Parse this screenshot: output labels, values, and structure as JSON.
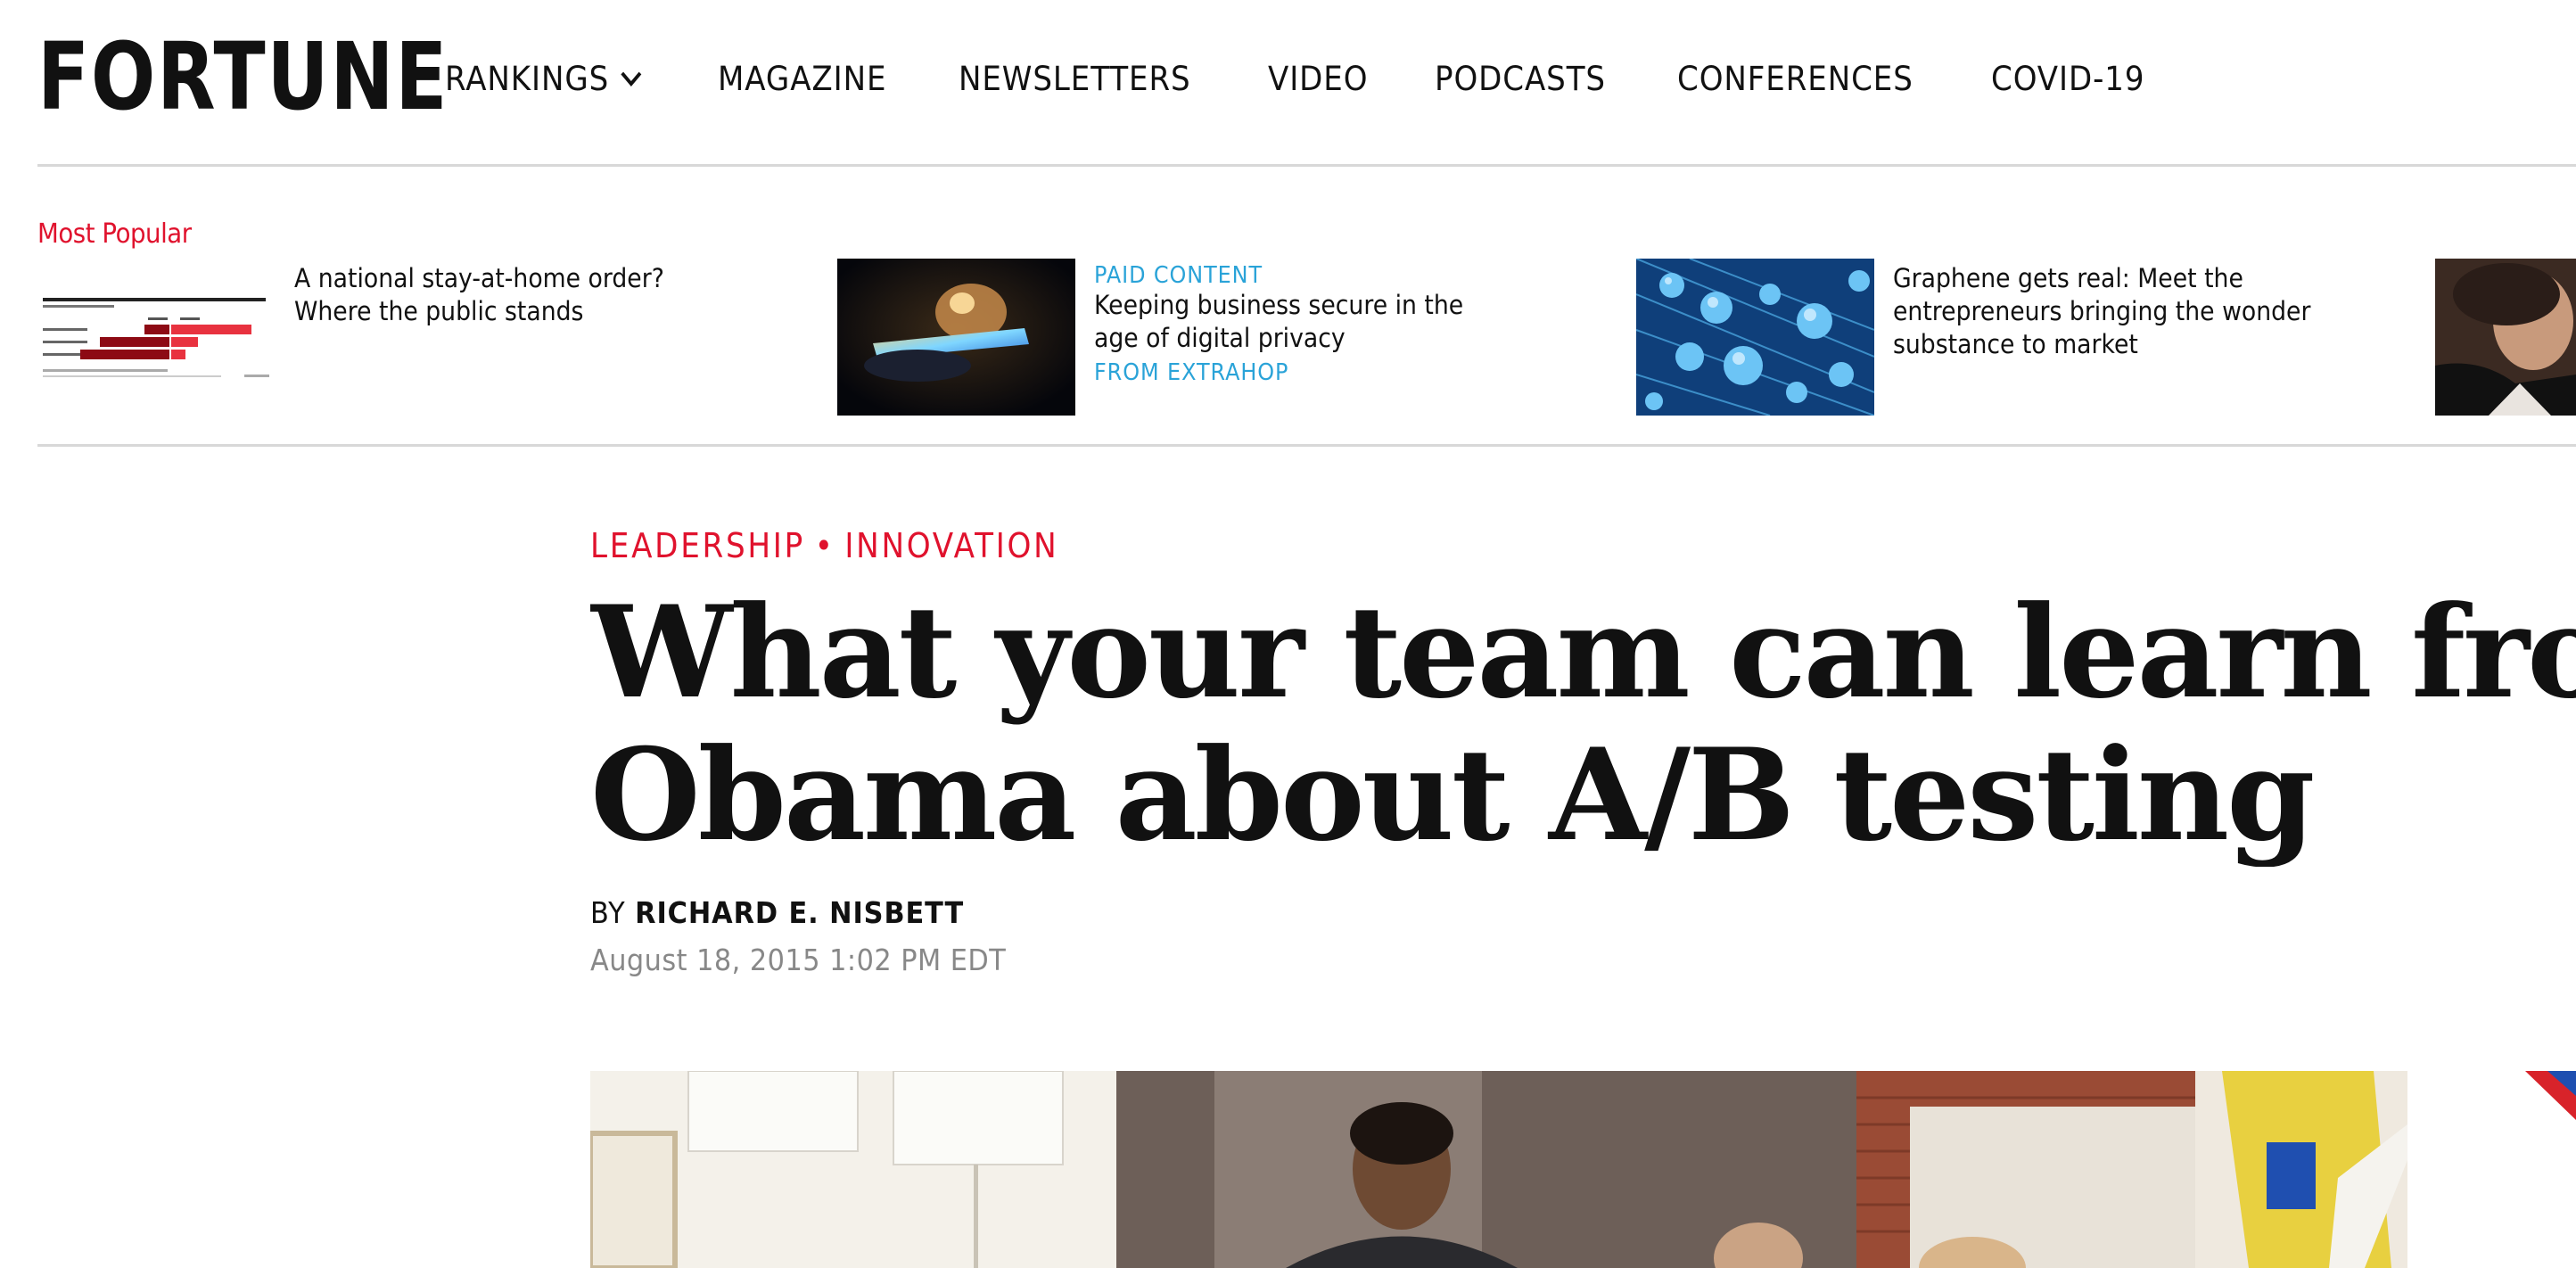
{
  "header": {
    "logo": "FORTUNE",
    "nav": [
      {
        "label": "RANKINGS",
        "has_dropdown": true
      },
      {
        "label": "MAGAZINE"
      },
      {
        "label": "NEWSLETTERS"
      },
      {
        "label": "VIDEO"
      },
      {
        "label": "PODCASTS"
      },
      {
        "label": "CONFERENCES"
      },
      {
        "label": "COVID-19"
      }
    ]
  },
  "most_popular": {
    "label": "Most Popular",
    "items": [
      {
        "title": "A national stay-at-home order? Where the public stands",
        "thumb_icon": "survey-bar-chart-thumbnail"
      },
      {
        "kicker": "PAID CONTENT",
        "title": "Keeping business secure in the age of digital privacy",
        "source": "FROM EXTRAHOP",
        "thumb_icon": "phone-in-hand-thumbnail"
      },
      {
        "title": "Graphene gets real: Meet the entrepreneurs bringing the wonder substance to market",
        "thumb_icon": "graphene-molecules-thumbnail"
      }
    ]
  },
  "article": {
    "categories": [
      "LEADERSHIP",
      "INNOVATION"
    ],
    "separator": "•",
    "headline_lines": [
      "What your team can learn from t",
      "Obama about A/B testing"
    ],
    "byline_prefix": "BY",
    "author": "RICHARD E. NISBETT",
    "date": "August 18, 2015 1:02 PM EDT"
  },
  "colors": {
    "brand_red": "#e0122d",
    "paid_blue": "#2aa3d8",
    "divider": "#d8d8d8",
    "muted_text": "#888888"
  }
}
